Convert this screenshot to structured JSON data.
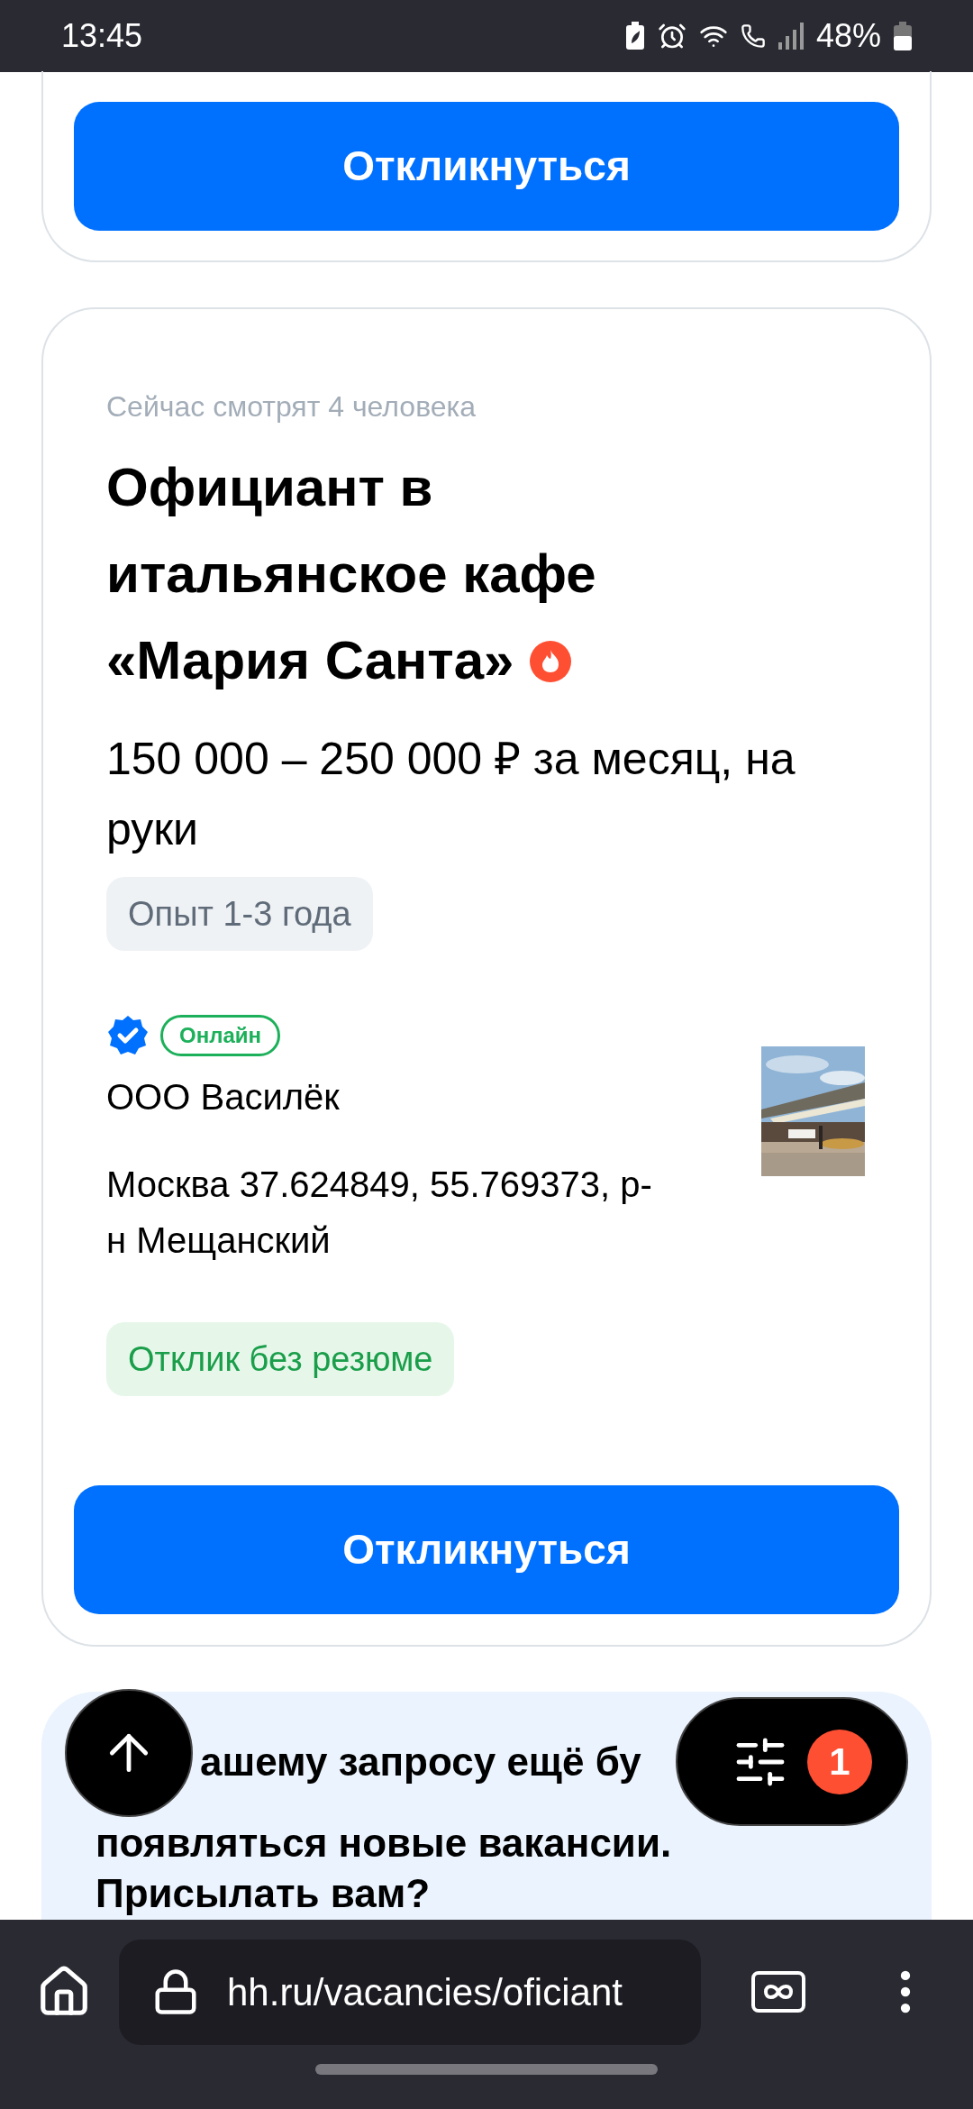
{
  "status_bar": {
    "time": "13:45",
    "battery": "48%"
  },
  "top_card": {
    "button": "Откликнуться"
  },
  "vacancy": {
    "viewers": "Сейчас смотрят 4 человека",
    "title": "Официант в итальянское кафе «Мария Санта»",
    "hot": true,
    "salary": "150 000 – 250 000 ₽ за месяц, на руки",
    "experience": "Опыт 1-3 года",
    "verified": true,
    "online": "Онлайн",
    "company": "ООО Василёк",
    "address": "Москва 37.624849, 55.769373, р-н Мещанский",
    "tag": "Отклик без резюме",
    "button": "Откликнуться"
  },
  "subscribe_banner": {
    "lines": [
      "ашему запросу ещё бу",
      "появляться новые вакансии.",
      "Присылать вам?"
    ]
  },
  "filter_button": {
    "badge": "1"
  },
  "browser": {
    "url": "hh.ru/vacancies/oficiant"
  }
}
